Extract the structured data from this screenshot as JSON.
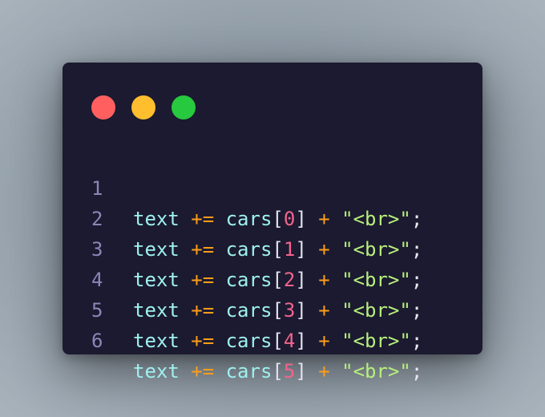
{
  "colors": {
    "close": "#ff5f5f",
    "minimize": "#ffbe2e",
    "maximize": "#27c93f",
    "line_number": "#8c86b8",
    "identifier": "#9ef0ef",
    "operator": "#ff9d1a",
    "bracket": "#e0e0ee",
    "index": "#f2648d",
    "string": "#b7ef7c",
    "semicolon": "#e8e8f0"
  },
  "code": {
    "lines": [
      {
        "number": "1",
        "var": "text",
        "op": "+=",
        "obj": "cars",
        "open": "[",
        "index": "0",
        "close": "]",
        "plus": "+",
        "str": "\"<br>\"",
        "end": ";"
      },
      {
        "number": "2",
        "var": "text",
        "op": "+=",
        "obj": "cars",
        "open": "[",
        "index": "1",
        "close": "]",
        "plus": "+",
        "str": "\"<br>\"",
        "end": ";"
      },
      {
        "number": "3",
        "var": "text",
        "op": "+=",
        "obj": "cars",
        "open": "[",
        "index": "2",
        "close": "]",
        "plus": "+",
        "str": "\"<br>\"",
        "end": ";"
      },
      {
        "number": "4",
        "var": "text",
        "op": "+=",
        "obj": "cars",
        "open": "[",
        "index": "3",
        "close": "]",
        "plus": "+",
        "str": "\"<br>\"",
        "end": ";"
      },
      {
        "number": "5",
        "var": "text",
        "op": "+=",
        "obj": "cars",
        "open": "[",
        "index": "4",
        "close": "]",
        "plus": "+",
        "str": "\"<br>\"",
        "end": ";"
      },
      {
        "number": "6",
        "var": "text",
        "op": "+=",
        "obj": "cars",
        "open": "[",
        "index": "5",
        "close": "]",
        "plus": "+",
        "str": "\"<br>\"",
        "end": ";"
      }
    ]
  }
}
